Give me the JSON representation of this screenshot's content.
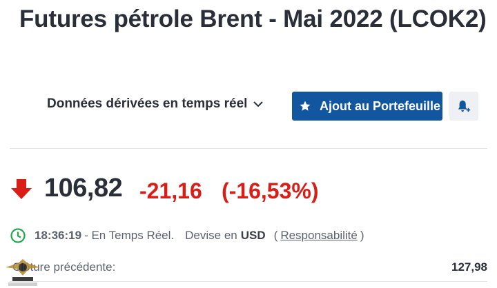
{
  "header": {
    "title": "Futures pétrole Brent - Mai 2022 (LCOK2)"
  },
  "toolbar": {
    "data_type_label": "Données dérivées en temps réel",
    "portfolio_label": "Ajout au Portefeuille",
    "accent_color": "#1256a0"
  },
  "quote": {
    "last": "106,82",
    "change": "-21,16",
    "change_pct": "(-16,53%)",
    "direction": "down",
    "negative_color": "#d91e18"
  },
  "status": {
    "time": "18:36:19",
    "mode": "- En Temps Réel.",
    "currency_label": "Devise en",
    "currency": "USD",
    "paren_open": "(",
    "disclaimer": "Responsabilité",
    "paren_close": ")"
  },
  "previous_close": {
    "label": "Clôture précédente:",
    "value": "127,98"
  },
  "icons": {
    "dropdown": "chevron-down-icon",
    "portfolio": "star-icon",
    "alert": "bell-plus-icon",
    "status": "clock-icon",
    "price_direction": "down-arrow-icon"
  }
}
